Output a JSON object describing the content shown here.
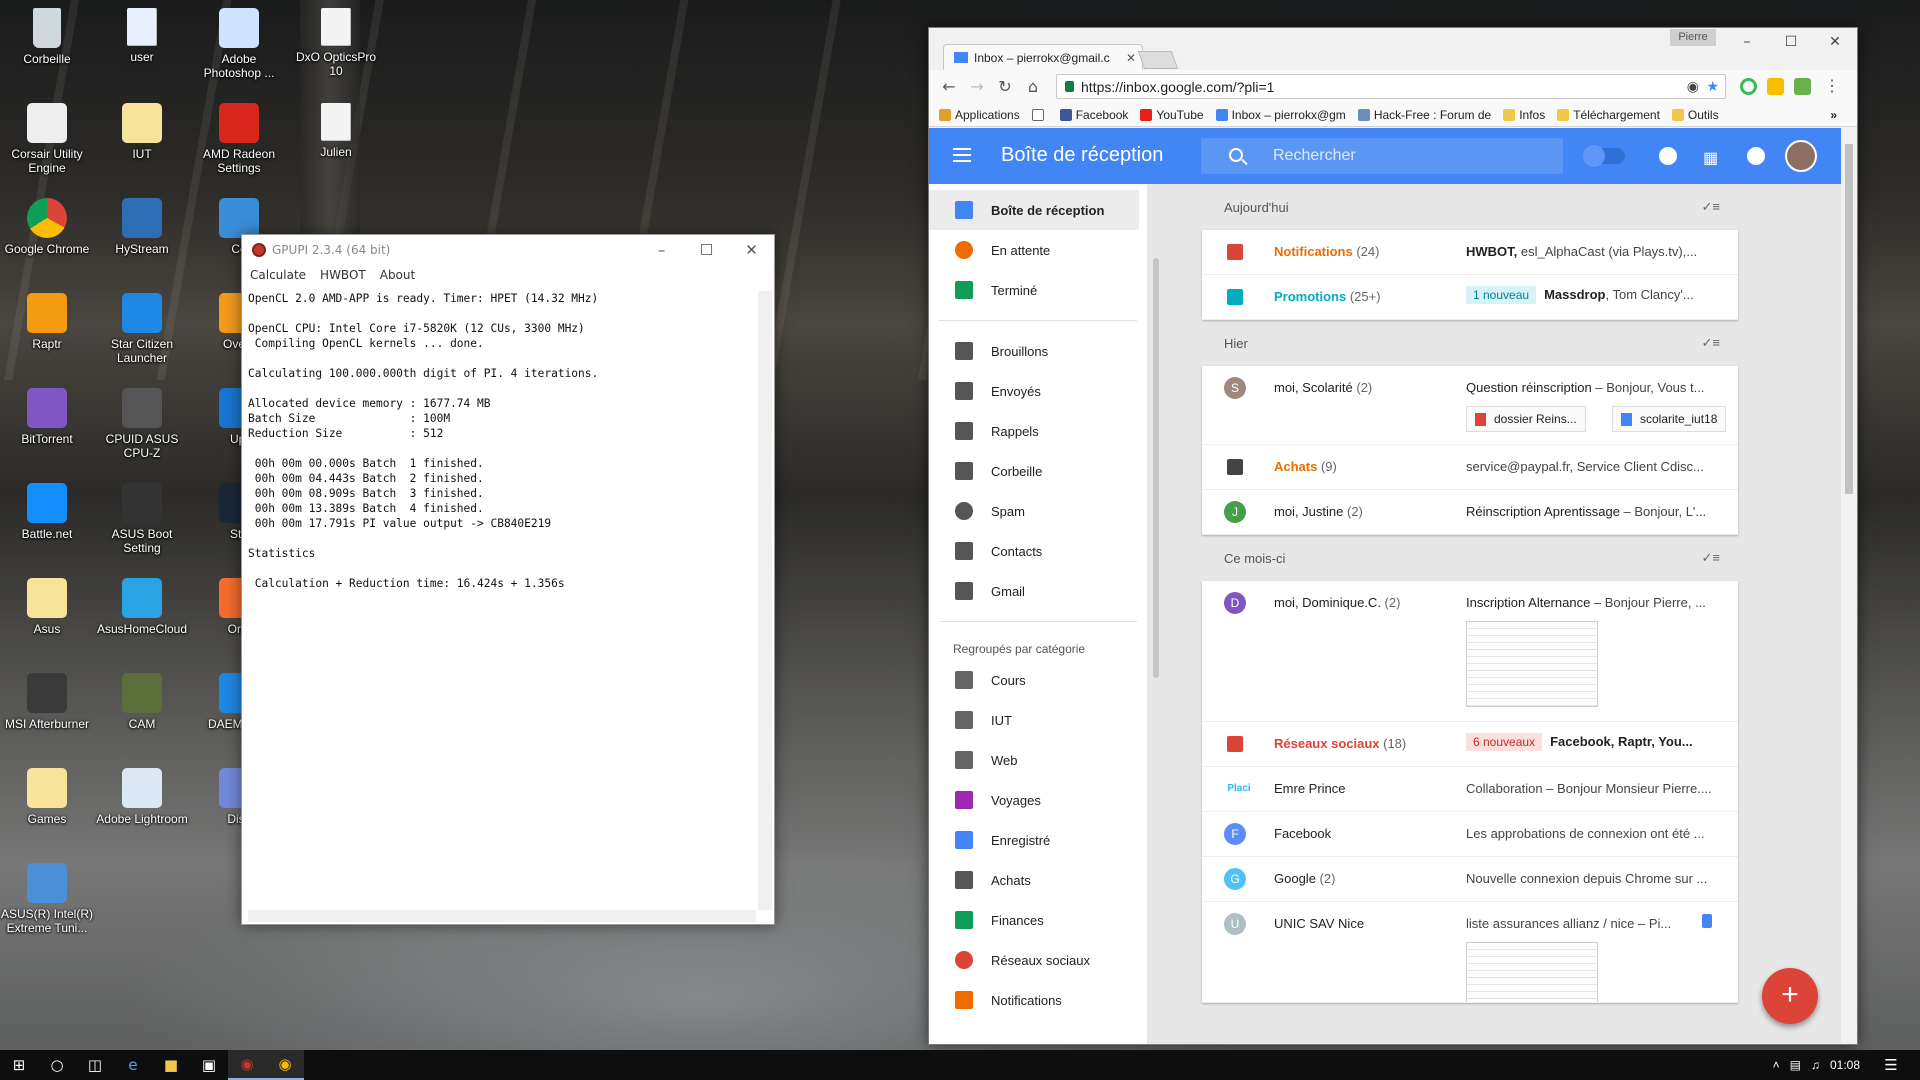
{
  "desktop_icons": [
    {
      "label": "Corbeille",
      "icon": "recycle-bin-icon",
      "color": "#cfd8dc"
    },
    {
      "label": "user",
      "icon": "document-icon",
      "color": "#e8f0ff"
    },
    {
      "label": "Adobe Photoshop ...",
      "icon": "photoshop-icon",
      "color": "#cfe2ff"
    },
    {
      "label": "DxO OpticsPro 10",
      "icon": "document-icon",
      "color": "#f4f4f4"
    },
    {
      "label": "Corsair Utility Engine",
      "icon": "corsair-icon",
      "color": "#eeeeee"
    },
    {
      "label": "IUT",
      "icon": "folder-doc-icon",
      "color": "#f7e39a"
    },
    {
      "label": "AMD Radeon Settings",
      "icon": "amd-radeon-icon",
      "color": "#d9261c"
    },
    {
      "label": "Julien",
      "icon": "document-icon",
      "color": "#f4f4f4"
    },
    {
      "label": "Google Chrome",
      "icon": "chrome-icon",
      "color": "#4caf50"
    },
    {
      "label": "HyStream",
      "icon": "hystream-icon",
      "color": "#2c6db5"
    },
    {
      "label": "Ce",
      "icon": "monitor-icon",
      "color": "#3a8ed8"
    },
    {
      "label": "Raptr",
      "icon": "raptr-icon",
      "color": "#f39c12"
    },
    {
      "label": "Star Citizen Launcher",
      "icon": "star-citizen-icon",
      "color": "#1e88e5"
    },
    {
      "label": "Overv",
      "icon": "overwatch-icon",
      "color": "#f29b1d"
    },
    {
      "label": "BitTorrent",
      "icon": "bittorrent-icon",
      "color": "#7e57c2"
    },
    {
      "label": "CPUID ASUS CPU-Z",
      "icon": "cpu-z-icon",
      "color": "#555555"
    },
    {
      "label": "Upl",
      "icon": "uplay-icon",
      "color": "#1976d2"
    },
    {
      "label": "Battle.net",
      "icon": "battlenet-icon",
      "color": "#148eff"
    },
    {
      "label": "ASUS Boot Setting",
      "icon": "asus-boot-icon",
      "color": "#333333"
    },
    {
      "label": "Ste",
      "icon": "steam-icon",
      "color": "#1b2838"
    },
    {
      "label": "Asus",
      "icon": "folder-doc-icon",
      "color": "#f7e39a"
    },
    {
      "label": "AsusHomeCloud",
      "icon": "asus-cloud-icon",
      "color": "#2aa3e3"
    },
    {
      "label": "Orig",
      "icon": "origin-icon",
      "color": "#f56c2d"
    },
    {
      "label": "MSI Afterburner",
      "icon": "msi-afterburner-icon",
      "color": "#3a3a3a"
    },
    {
      "label": "CAM",
      "icon": "cam-icon",
      "color": "#5a6d3a"
    },
    {
      "label": "DAEMO Ult",
      "icon": "daemon-tools-icon",
      "color": "#1e88e5"
    },
    {
      "label": "Games",
      "icon": "folder-doc-icon",
      "color": "#f7e39a"
    },
    {
      "label": "Adobe Lightroom",
      "icon": "lightroom-icon",
      "color": "#dde8f5"
    },
    {
      "label": "Disc",
      "icon": "discord-icon",
      "color": "#7289da"
    },
    {
      "label": "ASUS(R) Intel(R) Extreme Tuni...",
      "icon": "intel-xtu-icon",
      "color": "#4a90d9"
    }
  ],
  "gpupi": {
    "title": "GPUPI 2.3.4 (64 bit)",
    "menu": [
      "Calculate",
      "HWBOT",
      "About"
    ],
    "output": "OpenCL 2.0 AMD-APP is ready. Timer: HPET (14.32 MHz)\n\nOpenCL CPU: Intel Core i7-5820K (12 CUs, 3300 MHz)\n Compiling OpenCL kernels ... done.\n\nCalculating 100.000.000th digit of PI. 4 iterations.\n\nAllocated device memory : 1677.74 MB\nBatch Size              : 100M\nReduction Size          : 512\n\n 00h 00m 00.000s Batch  1 finished.\n 00h 00m 04.443s Batch  2 finished.\n 00h 00m 08.909s Batch  3 finished.\n 00h 00m 13.389s Batch  4 finished.\n 00h 00m 17.791s PI value output -> CB840E219\n\nStatistics\n\n Calculation + Reduction time: 16.424s + 1.356s"
  },
  "chrome": {
    "user": "Pierre",
    "tab_title": "Inbox – pierrokx@gmail.c",
    "url": "https://inbox.google.com/?pli=1",
    "bookmarks": [
      {
        "label": "Applications",
        "icon": "apps-grid-icon",
        "color": "#e0a030"
      },
      {
        "label": "",
        "icon": "page-icon",
        "color": "#ffffff"
      },
      {
        "label": "Facebook",
        "icon": "facebook-icon",
        "color": "#3b5998"
      },
      {
        "label": "YouTube",
        "icon": "youtube-icon",
        "color": "#e62117"
      },
      {
        "label": "Inbox – pierrokx@gm",
        "icon": "inbox-icon",
        "color": "#4285f4"
      },
      {
        "label": "Hack-Free : Forum de",
        "icon": "hackfree-icon",
        "color": "#6c8ebf"
      },
      {
        "label": "Infos",
        "icon": "folder-icon",
        "color": "#f2c84b"
      },
      {
        "label": "Téléchargement",
        "icon": "folder-icon",
        "color": "#f2c84b"
      },
      {
        "label": "Outils",
        "icon": "folder-icon",
        "color": "#f2c84b"
      }
    ],
    "more": "»"
  },
  "inbox": {
    "title": "Boîte de réception",
    "search_placeholder": "Rechercher",
    "nav": [
      {
        "label": "Boîte de réception",
        "icon": "inbox-icon",
        "color": "#4285f4",
        "active": true
      },
      {
        "label": "En attente",
        "icon": "clock-icon",
        "color": "#ef6c00"
      },
      {
        "label": "Terminé",
        "icon": "check-icon",
        "color": "#0f9d58"
      }
    ],
    "nav2": [
      {
        "label": "Brouillons",
        "icon": "drafts-icon",
        "color": "#555555"
      },
      {
        "label": "Envoyés",
        "icon": "send-icon",
        "color": "#555555"
      },
      {
        "label": "Rappels",
        "icon": "reminder-icon",
        "color": "#555555"
      },
      {
        "label": "Corbeille",
        "icon": "trash-icon",
        "color": "#555555"
      },
      {
        "label": "Spam",
        "icon": "spam-icon",
        "color": "#555555"
      },
      {
        "label": "Contacts",
        "icon": "contacts-icon",
        "color": "#555555"
      },
      {
        "label": "Gmail",
        "icon": "gmail-icon",
        "color": "#555555"
      }
    ],
    "group_title": "Regroupés par catégorie",
    "groups": [
      {
        "label": "Cours",
        "icon": "label-mail-icon",
        "color": "#666666"
      },
      {
        "label": "IUT",
        "icon": "label-mail-icon",
        "color": "#666666"
      },
      {
        "label": "Web",
        "icon": "label-mail-icon",
        "color": "#666666"
      },
      {
        "label": "Voyages",
        "icon": "plane-icon",
        "color": "#9c27b0"
      },
      {
        "label": "Enregistré",
        "icon": "bookmark-icon",
        "color": "#4285f4"
      },
      {
        "label": "Achats",
        "icon": "cart-icon",
        "color": "#555555"
      },
      {
        "label": "Finances",
        "icon": "chart-icon",
        "color": "#0f9d58"
      },
      {
        "label": "Réseaux sociaux",
        "icon": "people-icon",
        "color": "#db4437"
      },
      {
        "label": "Notifications",
        "icon": "flag-icon",
        "color": "#ef6c00"
      }
    ],
    "sections": {
      "today": "Aujourd'hui",
      "yesterday": "Hier",
      "month": "Ce mois-ci"
    },
    "today": [
      {
        "name": "Notifications",
        "count": "(24)",
        "name_color": "#ef6c00",
        "icon": "flag-icon",
        "icon_color": "#db4437",
        "preview_bold": "HWBOT,",
        "preview": " esl_AlphaCast (via Plays.tv),..."
      },
      {
        "name": "Promotions",
        "count": "(25+)",
        "name_color": "#00acc1",
        "icon": "tag-icon",
        "icon_color": "#00acc1",
        "badge": "1 nouveau",
        "badge_bg": "#d6f3f7",
        "badge_color": "#00838f",
        "preview_bold": "Massdrop",
        "preview": ", Tom Clancy'..."
      }
    ],
    "yesterday": [
      {
        "name": "moi, Scolarité",
        "count": "(2)",
        "avatar": "S",
        "avatar_color": "#a1887f",
        "subject": "Question réinscription",
        "preview": " – Bonjour, Vous t...",
        "chips": [
          "dossier Reins...",
          "scolarite_iut18"
        ]
      },
      {
        "name": "Achats",
        "count": "(9)",
        "name_color": "#ef6c00",
        "icon": "cart-icon",
        "icon_color": "#444444",
        "preview": "service@paypal.fr, Service Client Cdisc..."
      },
      {
        "name": "moi, Justine",
        "count": "(2)",
        "avatar": "J",
        "avatar_color": "#43a047",
        "subject": "Réinscription Aprentissage",
        "preview": " – Bonjour, L'..."
      }
    ],
    "month": [
      {
        "name": "moi, Dominique.C.",
        "count": "(2)",
        "avatar": "D",
        "avatar_color": "#7e57c2",
        "subject": "Inscription Alternance",
        "preview": " – Bonjour Pierre, ..."
      },
      {
        "name": "Réseaux sociaux",
        "count": "(18)",
        "name_color": "#db4437",
        "icon": "people-icon",
        "icon_color": "#db4437",
        "badge": "6 nouveaux",
        "badge_bg": "#fbe0dd",
        "badge_color": "#c62828",
        "preview_bold": "Facebook, Raptr, You..."
      },
      {
        "name": "Emre Prince",
        "count": "",
        "avatar": "Placi",
        "avatar_color": "#29b6f6",
        "preview": "Collaboration – Bonjour Monsieur Pierre...."
      },
      {
        "name": "Facebook",
        "count": "",
        "avatar": "F",
        "avatar_color": "#5c8df6",
        "preview": "Les approbations de connexion ont été ..."
      },
      {
        "name": "Google",
        "count": "(2)",
        "avatar": "G",
        "avatar_color": "#4fc3f7",
        "preview": "Nouvelle connexion depuis Chrome sur ..."
      },
      {
        "name": "UNIC SAV Nice",
        "count": "",
        "avatar": "U",
        "avatar_color": "#b0bec5",
        "preview": "liste assurances allianz / nice – Pi..."
      }
    ],
    "fab": "+"
  },
  "taskbar": {
    "time": "01:08"
  }
}
